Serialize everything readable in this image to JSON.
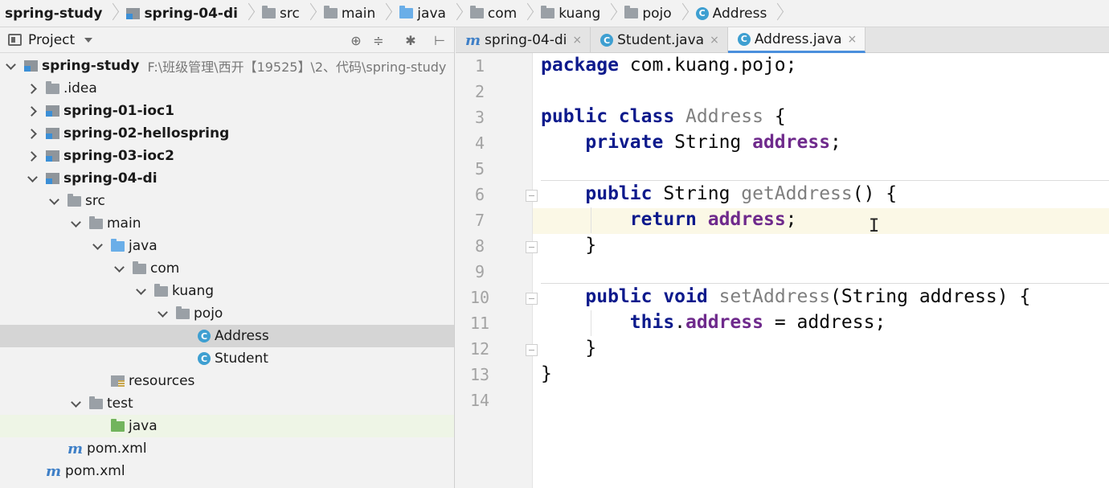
{
  "breadcrumbs": [
    {
      "label": "spring-study",
      "icon": "none",
      "bold": true
    },
    {
      "label": "spring-04-di",
      "icon": "module-icon",
      "bold": true
    },
    {
      "label": "src",
      "icon": "folder-icon",
      "bold": false
    },
    {
      "label": "main",
      "icon": "folder-icon",
      "bold": false
    },
    {
      "label": "java",
      "icon": "source-folder-icon",
      "bold": false
    },
    {
      "label": "com",
      "icon": "package-icon",
      "bold": false
    },
    {
      "label": "kuang",
      "icon": "package-icon",
      "bold": false
    },
    {
      "label": "pojo",
      "icon": "package-icon",
      "bold": false
    },
    {
      "label": "Address",
      "icon": "class-icon",
      "bold": false
    }
  ],
  "project_panel": {
    "title": "Project",
    "tools": [
      "target-icon",
      "collapse-icon",
      "gear-icon",
      "pin-icon"
    ]
  },
  "tree": [
    {
      "label": "spring-study",
      "path": "F:\\班级管理\\西开【19525】\\2、代码\\spring-study",
      "depth": 0,
      "arrow": "down",
      "icon": "module",
      "bold": true
    },
    {
      "label": ".idea",
      "depth": 1,
      "arrow": "right",
      "icon": "folder",
      "bold": false
    },
    {
      "label": "spring-01-ioc1",
      "depth": 1,
      "arrow": "right",
      "icon": "module",
      "bold": true
    },
    {
      "label": "spring-02-hellospring",
      "depth": 1,
      "arrow": "right",
      "icon": "module",
      "bold": true
    },
    {
      "label": "spring-03-ioc2",
      "depth": 1,
      "arrow": "right",
      "icon": "module",
      "bold": true
    },
    {
      "label": "spring-04-di",
      "depth": 1,
      "arrow": "down",
      "icon": "module",
      "bold": true
    },
    {
      "label": "src",
      "depth": 2,
      "arrow": "down",
      "icon": "folder",
      "bold": false
    },
    {
      "label": "main",
      "depth": 3,
      "arrow": "down",
      "icon": "folder",
      "bold": false
    },
    {
      "label": "java",
      "depth": 4,
      "arrow": "down",
      "icon": "folder-blue",
      "bold": false
    },
    {
      "label": "com",
      "depth": 5,
      "arrow": "down",
      "icon": "folder",
      "bold": false
    },
    {
      "label": "kuang",
      "depth": 6,
      "arrow": "down",
      "icon": "folder",
      "bold": false
    },
    {
      "label": "pojo",
      "depth": 7,
      "arrow": "down",
      "icon": "folder",
      "bold": false
    },
    {
      "label": "Address",
      "depth": 8,
      "arrow": "none",
      "icon": "class",
      "bold": false,
      "selected": true
    },
    {
      "label": "Student",
      "depth": 8,
      "arrow": "none",
      "icon": "class",
      "bold": false
    },
    {
      "label": "resources",
      "depth": 4,
      "arrow": "none",
      "icon": "resources",
      "bold": false
    },
    {
      "label": "test",
      "depth": 3,
      "arrow": "down",
      "icon": "folder",
      "bold": false
    },
    {
      "label": "java",
      "depth": 4,
      "arrow": "none",
      "icon": "folder-green",
      "bold": false,
      "hover": true
    },
    {
      "label": "pom.xml",
      "depth": 2,
      "arrow": "none",
      "icon": "maven",
      "bold": false
    },
    {
      "label": "pom.xml",
      "depth": 1,
      "arrow": "none",
      "icon": "maven",
      "bold": false
    }
  ],
  "tabs": [
    {
      "label": "spring-04-di",
      "icon": "maven",
      "close": "×",
      "active": false
    },
    {
      "label": "Student.java",
      "icon": "class",
      "close": "×",
      "active": false
    },
    {
      "label": "Address.java",
      "icon": "class",
      "close": "×",
      "active": true
    }
  ],
  "editor": {
    "line_numbers": [
      "1",
      "2",
      "3",
      "4",
      "5",
      "6",
      "7",
      "8",
      "9",
      "10",
      "11",
      "12",
      "13",
      "14"
    ],
    "lines": [
      [
        {
          "t": "package",
          "c": "kw"
        },
        {
          "t": " com.kuang.pojo;",
          "c": ""
        }
      ],
      [],
      [
        {
          "t": "public class",
          "c": "kw"
        },
        {
          "t": " ",
          "c": ""
        },
        {
          "t": "Address",
          "c": "dim"
        },
        {
          "t": " {",
          "c": ""
        }
      ],
      [
        {
          "t": "    ",
          "c": ""
        },
        {
          "t": "private",
          "c": "kw"
        },
        {
          "t": " String ",
          "c": ""
        },
        {
          "t": "address",
          "c": "fld"
        },
        {
          "t": ";",
          "c": ""
        }
      ],
      [],
      [
        {
          "t": "    ",
          "c": ""
        },
        {
          "t": "public",
          "c": "kw"
        },
        {
          "t": " String ",
          "c": ""
        },
        {
          "t": "getAddress",
          "c": "dim"
        },
        {
          "t": "() {",
          "c": ""
        }
      ],
      [
        {
          "t": "        ",
          "c": ""
        },
        {
          "t": "return",
          "c": "kw"
        },
        {
          "t": " ",
          "c": ""
        },
        {
          "t": "address",
          "c": "fld"
        },
        {
          "t": ";",
          "c": ""
        }
      ],
      [
        {
          "t": "    }",
          "c": ""
        }
      ],
      [],
      [
        {
          "t": "    ",
          "c": ""
        },
        {
          "t": "public void",
          "c": "kw"
        },
        {
          "t": " ",
          "c": ""
        },
        {
          "t": "setAddress",
          "c": "dim"
        },
        {
          "t": "(String address) {",
          "c": ""
        }
      ],
      [
        {
          "t": "        ",
          "c": ""
        },
        {
          "t": "this",
          "c": "kw"
        },
        {
          "t": ".",
          "c": ""
        },
        {
          "t": "address",
          "c": "fld"
        },
        {
          "t": " = address;",
          "c": ""
        }
      ],
      [
        {
          "t": "    }",
          "c": ""
        }
      ],
      [
        {
          "t": "}",
          "c": ""
        }
      ],
      []
    ],
    "current_line": "7",
    "text_cursor": "I"
  }
}
